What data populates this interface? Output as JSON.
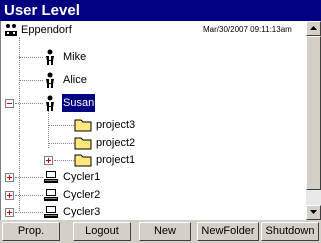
{
  "window": {
    "title": "User Level"
  },
  "tree": {
    "root": {
      "label": "Eppendorf",
      "timestamp": "Mar/30/2007 09:11:13am",
      "icon": "users-group-icon"
    },
    "users": [
      {
        "label": "Mike",
        "icon": "user-icon"
      },
      {
        "label": "Alice",
        "icon": "user-icon"
      },
      {
        "label": "Susan",
        "icon": "user-icon",
        "selected": true,
        "expanded": true
      }
    ],
    "projects": [
      {
        "label": "project3",
        "icon": "folder-icon"
      },
      {
        "label": "project2",
        "icon": "folder-icon"
      },
      {
        "label": "project1",
        "icon": "folder-icon",
        "expandable": true
      }
    ],
    "cyclers": [
      {
        "label": "Cycler1",
        "icon": "computer-icon"
      },
      {
        "label": "Cycler2",
        "icon": "computer-icon"
      },
      {
        "label": "Cycler3",
        "icon": "computer-icon"
      }
    ]
  },
  "buttons": {
    "prop": "Prop.",
    "logout": "Logout",
    "new": "New",
    "newfolder": "NewFolder",
    "shutdown": "Shutdown"
  },
  "colors": {
    "title_bg": "#000080",
    "selection_bg": "#000080",
    "expander_sign": "#cc0000",
    "folder": "#ffe87c"
  }
}
